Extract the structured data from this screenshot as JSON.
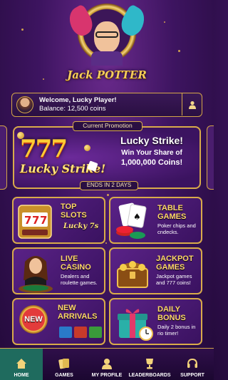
{
  "header": {
    "logo_text": "Jack POTTER"
  },
  "player": {
    "welcome": "Welcome, Lucky Player!",
    "balance": "Balance: 12,500 coins"
  },
  "promo": {
    "tag": "Current Promotion",
    "art_number": "777",
    "art_text": "Lucky Strike!",
    "title": "Lucky Strike!",
    "subtitle": "Win Your Share of",
    "amount": "1,000,000 Coins!",
    "ends": "ENDS IN 2 DAYS"
  },
  "tiles": [
    {
      "title": "TOP SLOTS",
      "desc": ""
    },
    {
      "title": "TABLE GAMES",
      "desc": "Poker chips and cndecks."
    },
    {
      "title": "LIVE CASINO",
      "desc": "Dealers and roulette games."
    },
    {
      "title": "JACKPOT GAMES",
      "desc": "Jackpot games and 777 coins!"
    },
    {
      "title": "NEW ARRIVALS",
      "desc": ""
    },
    {
      "title": "DAILY BONUS",
      "desc": "Daily 2 bonus in rio timer!"
    }
  ],
  "tile_art": {
    "slots_label": "Lucky 7s",
    "new_badge": "NEW"
  },
  "nav": {
    "items": [
      {
        "label": "HOME",
        "icon": "home-icon"
      },
      {
        "label": "GAMES",
        "icon": "cards-icon"
      },
      {
        "label": "MY PROFILE",
        "icon": "profile-icon"
      },
      {
        "label": "LEADERBOARDS",
        "icon": "trophy-icon"
      },
      {
        "label": "SUPPORT",
        "icon": "headset-icon"
      }
    ],
    "active": "HOME"
  },
  "colors": {
    "gold": "#d9ab4a",
    "purple": "#3d1460",
    "active_nav": "#1f6b5e"
  }
}
